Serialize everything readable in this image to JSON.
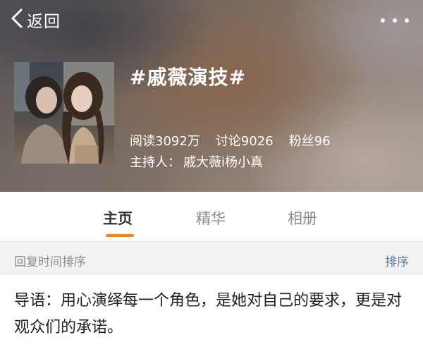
{
  "nav": {
    "back_label": "返回"
  },
  "topic": {
    "title": "#戚薇演技#",
    "stats": {
      "reads": "阅读3092万",
      "discussions": "讨论9026",
      "fans": "粉丝96"
    },
    "host_label": "主持人：",
    "host_names": "戚大薇i杨小真"
  },
  "tabs": [
    {
      "label": "主页",
      "active": true
    },
    {
      "label": "精华",
      "active": false
    },
    {
      "label": "相册",
      "active": false
    }
  ],
  "sort_bar": {
    "label": "回复时间排序",
    "button": "排序"
  },
  "intro": {
    "text": "导语：用心演绎每一个角色，是她对自己的要求，更是对观众们的承诺。"
  },
  "colors": {
    "accent": "#ff8200",
    "link": "#5a7ca6",
    "sort_bar_bg": "#f2f2f2"
  },
  "icons": {
    "back": "chevron-left-icon",
    "more": "more-dots-icon"
  }
}
